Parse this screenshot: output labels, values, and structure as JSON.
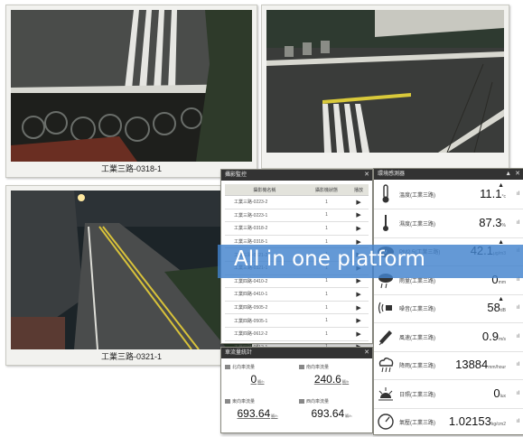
{
  "cameras": [
    {
      "caption": "工業三路-0318-1"
    },
    {
      "caption": ""
    },
    {
      "caption": "工業三路-0321-1"
    }
  ],
  "list_panel": {
    "title": "攝影監控",
    "headers": [
      "攝影機名稱",
      "攝影機狀態",
      "播放"
    ],
    "rows": [
      {
        "name": "工業三路-0223-2",
        "status": "1"
      },
      {
        "name": "工業三路-0223-1",
        "status": "1"
      },
      {
        "name": "工業三路-0318-2",
        "status": "1"
      },
      {
        "name": "工業三路-0318-1",
        "status": "1"
      },
      {
        "name": "工業三路-0321-2",
        "status": "1"
      },
      {
        "name": "工業三路-0321-1",
        "status": "1"
      },
      {
        "name": "工業四路-0410-2",
        "status": "1"
      },
      {
        "name": "工業四路-0410-1",
        "status": "1"
      },
      {
        "name": "工業四路-0505-2",
        "status": "1"
      },
      {
        "name": "工業四路-0505-1",
        "status": "1"
      },
      {
        "name": "工業四路-0612-2",
        "status": "1"
      },
      {
        "name": "工業四路-0612-1",
        "status": "1"
      }
    ],
    "play_glyph": "▶"
  },
  "traffic_panel": {
    "title": "車流量統計",
    "cells": [
      {
        "label": "北向車流量",
        "value": "0",
        "unit": "輛/h"
      },
      {
        "label": "南向車流量",
        "value": "240.6",
        "unit": "輛/h"
      },
      {
        "label": "東向車流量",
        "value": "693.64",
        "unit": "輛/h"
      },
      {
        "label": "西向車流量",
        "value": "693.64",
        "unit": "輛/h"
      }
    ]
  },
  "env_panel": {
    "title": "環境感測器",
    "title_buttons": "▲ ✕",
    "rows": [
      {
        "icon": "thermometer-icon",
        "name": "溫度(工業三路)",
        "value": "11.1",
        "unit": "°c",
        "trend": "up"
      },
      {
        "icon": "humidity-icon",
        "name": "濕度(工業三路)",
        "value": "87.3",
        "unit": "%",
        "trend": ""
      },
      {
        "icon": "pm25-cloud-icon",
        "name": "PM2.5(工業三路)",
        "value": "42.1",
        "unit": "μg/m3",
        "trend": "up"
      },
      {
        "icon": "rain-icon",
        "name": "雨量(工業三路)",
        "value": "0",
        "unit": "mm",
        "trend": ""
      },
      {
        "icon": "noise-icon",
        "name": "噪音(工業三路)",
        "value": "58",
        "unit": "dB",
        "trend": "up"
      },
      {
        "icon": "wind-icon",
        "name": "風速(工業三路)",
        "value": "0.9",
        "unit": "m/s",
        "trend": ""
      },
      {
        "icon": "cloud-rain-icon",
        "name": "降雨(工業三路)",
        "value": "13884",
        "unit": "mm/hour",
        "trend": ""
      },
      {
        "icon": "sun-icon",
        "name": "日照(工業三路)",
        "value": "0",
        "unit": "lux",
        "trend": ""
      },
      {
        "icon": "gauge-icon",
        "name": "氣壓(工業三路)",
        "value": "1.02153",
        "unit": "kg/cm2",
        "trend": ""
      }
    ]
  },
  "banner": {
    "text": "All in one platform"
  },
  "colors": {
    "banner": "#4282cd",
    "title_bar": "#333333",
    "frame": "#f2f2ef"
  }
}
